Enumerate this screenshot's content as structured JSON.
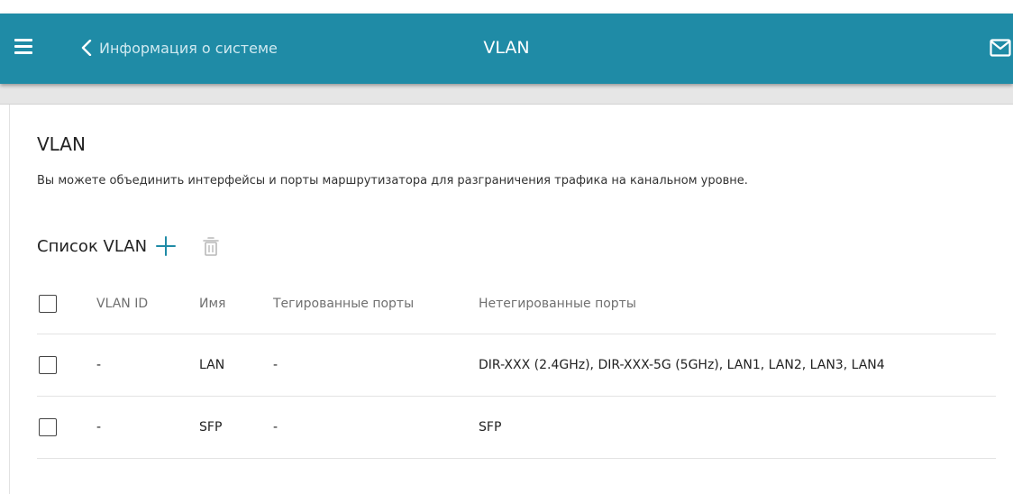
{
  "header": {
    "back_label": "Информация о системе",
    "title": "VLAN",
    "bar_color": "#1f8ba6",
    "icons": [
      "menu-icon",
      "chevron-left-icon",
      "mail-icon"
    ]
  },
  "section": {
    "title": "VLAN",
    "description": "Вы можете объединить интерфейсы и порты маршрутизатора для разграничения трафика на канальном уровне."
  },
  "list": {
    "title": "Список VLAN",
    "add_icon": "plus-icon",
    "delete_icon": "trash-icon",
    "columns": {
      "vlan_id": "VLAN ID",
      "name": "Имя",
      "tagged": "Тегированные порты",
      "untagged": "Нетегированные порты"
    },
    "rows": [
      {
        "vlan_id": "-",
        "name": "LAN",
        "tagged": "-",
        "untagged": "DIR-XXX (2.4GHz), DIR-XXX-5G (5GHz), LAN1, LAN2, LAN3, LAN4"
      },
      {
        "vlan_id": "-",
        "name": "SFP",
        "tagged": "-",
        "untagged": "SFP"
      }
    ]
  }
}
